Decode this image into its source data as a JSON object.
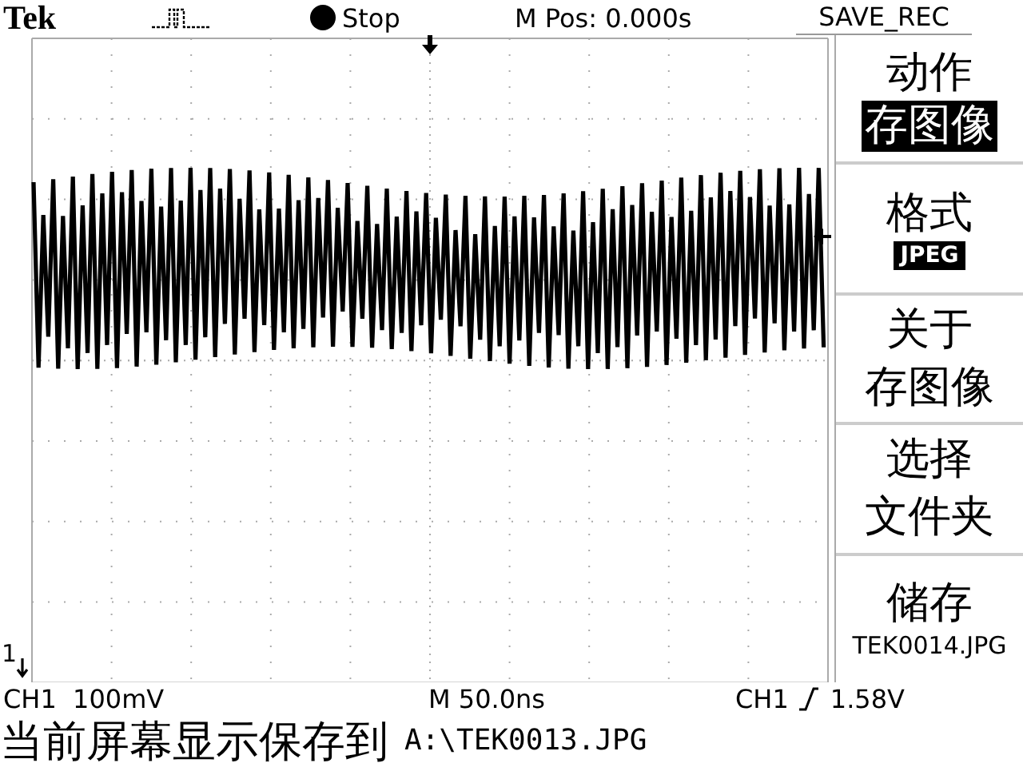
{
  "top_bar": {
    "brand": "Tek",
    "run_state": "Stop",
    "position": "M Pos: 0.000s",
    "menu_title": "SAVE_REC"
  },
  "markers": {
    "channel": "1"
  },
  "menu": [
    {
      "kind": "inverted-large",
      "label": [
        "动作"
      ],
      "value": "存图像"
    },
    {
      "kind": "inverted-small",
      "label": [
        "格式"
      ],
      "value": "JPEG"
    },
    {
      "kind": "plain",
      "label": [
        "关于",
        "存图像"
      ]
    },
    {
      "kind": "plain",
      "label": [
        "选择",
        "文件夹"
      ]
    },
    {
      "kind": "plain-small",
      "label": [
        "储存"
      ],
      "value": "TEK0014.JPG"
    }
  ],
  "readout": {
    "channel_scale": "CH1  100mV",
    "timebase": "M 50.0ns",
    "trigger_source": "CH1",
    "trigger_level": "1.58V"
  },
  "status": {
    "message": "当前屏幕显示保存到",
    "path": "A:\\TEK0013.JPG"
  }
}
